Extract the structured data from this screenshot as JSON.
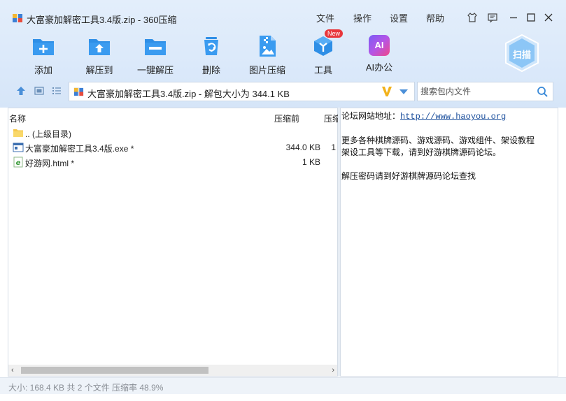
{
  "window": {
    "title": "大富豪加解密工具3.4版.zip - 360压缩"
  },
  "menu": {
    "file": "文件",
    "operate": "操作",
    "settings": "设置",
    "help": "帮助"
  },
  "toolbar": {
    "items": [
      {
        "label": "添加",
        "icon": "add-icon"
      },
      {
        "label": "解压到",
        "icon": "extract-to-icon"
      },
      {
        "label": "一键解压",
        "icon": "one-click-extract-icon"
      },
      {
        "label": "删除",
        "icon": "delete-icon"
      },
      {
        "label": "图片压缩",
        "icon": "image-compress-icon"
      },
      {
        "label": "工具",
        "icon": "tools-icon",
        "badge": "New"
      },
      {
        "label": "AI办公",
        "icon": "ai-office-icon",
        "icon_text": "AI"
      }
    ],
    "scan_label": "扫描"
  },
  "address": {
    "path": "大富豪加解密工具3.4版.zip - 解包大小为 344.1 KB",
    "search_placeholder": "搜索包内文件"
  },
  "file_list": {
    "columns": {
      "name": "名称",
      "size_before": "压缩前",
      "size_after": "压缩"
    },
    "rows": [
      {
        "name": ".. (上级目录)",
        "size": "",
        "extra": "",
        "icon": "folder-icon"
      },
      {
        "name": "大富豪加解密工具3.4版.exe *",
        "size": "344.0 KB",
        "extra": "1",
        "icon": "exe-file-icon"
      },
      {
        "name": "好游网.html *",
        "size": "1 KB",
        "extra": "",
        "icon": "html-file-icon"
      }
    ]
  },
  "comment": {
    "line1_label": "论坛网站地址：",
    "line1_link": "http://www.haoyou.org",
    "line2": "更多各种棋牌源码、游戏源码、游戏组件、架设教程",
    "line3": "架设工具等下载，请到好游棋牌源码论坛。",
    "line4": "解压密码请到好游棋牌源码论坛查找"
  },
  "status": {
    "text": "大小: 168.4 KB 共 2 个文件 压缩率 48.9%"
  },
  "colors": {
    "accent": "#2f8fe6",
    "badge_red": "#e8373c",
    "ai_gradient_start": "#7b5cf5",
    "ai_gradient_end": "#f0488a"
  }
}
